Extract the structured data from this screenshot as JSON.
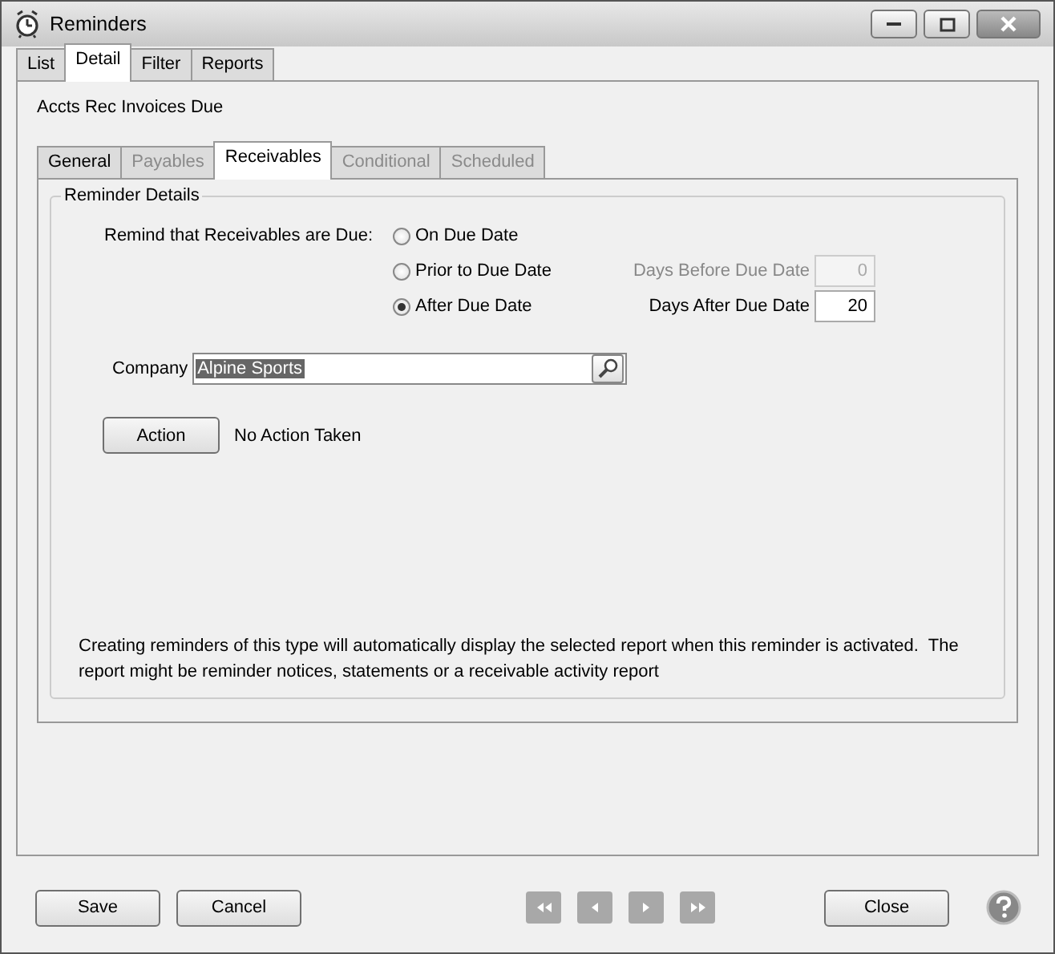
{
  "window": {
    "title": "Reminders"
  },
  "tabs": [
    {
      "label": "List",
      "selected": false
    },
    {
      "label": "Detail",
      "selected": true
    },
    {
      "label": "Filter",
      "selected": false
    },
    {
      "label": "Reports",
      "selected": false
    }
  ],
  "reminder_name": "Accts Rec Invoices Due",
  "sub_tabs": [
    {
      "label": "General",
      "selected": false,
      "disabled": false
    },
    {
      "label": "Payables",
      "selected": false,
      "disabled": true
    },
    {
      "label": "Receivables",
      "selected": true,
      "disabled": false
    },
    {
      "label": "Conditional",
      "selected": false,
      "disabled": true
    },
    {
      "label": "Scheduled",
      "selected": false,
      "disabled": true
    }
  ],
  "group": {
    "title": "Reminder Details",
    "prompt": "Remind that Receivables are Due:",
    "options": [
      {
        "label": "On Due Date",
        "selected": false
      },
      {
        "label": "Prior to Due Date",
        "selected": false
      },
      {
        "label": "After Due Date",
        "selected": true
      }
    ],
    "fields": [
      {
        "label": "Days Before Due Date",
        "value": "0",
        "disabled": true
      },
      {
        "label": "Days After Due Date",
        "value": "20",
        "disabled": false
      }
    ],
    "company": {
      "label": "Company",
      "value": "Alpine Sports",
      "text_selected": true
    },
    "action": {
      "button": "Action",
      "status": "No Action Taken"
    },
    "note": "Creating reminders of this type will automatically display the selected report when this reminder is activated.  The report might be reminder notices, statements or a receivable activity report"
  },
  "footer": {
    "left_buttons": [
      "Save",
      "Cancel"
    ],
    "nav": [
      {
        "kind": "first",
        "disabled": true
      },
      {
        "kind": "prev",
        "disabled": true
      },
      {
        "kind": "next",
        "disabled": true
      },
      {
        "kind": "last",
        "disabled": true
      }
    ],
    "close": "Close"
  }
}
